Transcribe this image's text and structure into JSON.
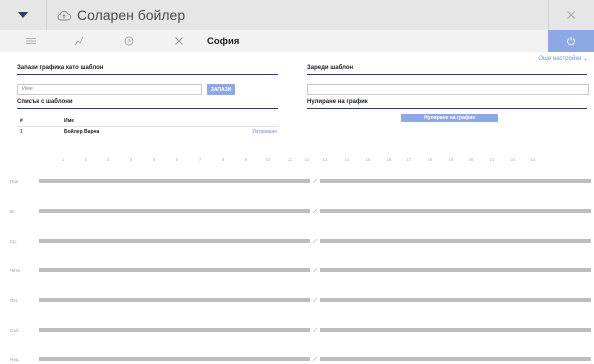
{
  "header": {
    "title": "Соларен бойлер"
  },
  "tabs": {
    "city": "София"
  },
  "more_settings": "Още настройки ⌄",
  "save_template": {
    "title": "Запази графика като шаблон",
    "name_placeholder": "Име",
    "save_button": "ЗАПАЗИ"
  },
  "load_template": {
    "title": "Зареди шаблон",
    "value": ""
  },
  "template_list": {
    "title": "Списък с шаблони",
    "columns": [
      "#",
      "Име"
    ],
    "rows": [
      {
        "num": "1",
        "name": "Бойлер Варна",
        "action": "Изтриване"
      }
    ]
  },
  "reset_schedule": {
    "title": "Нулиране на график",
    "button": "Нулиране на график"
  },
  "hours": [
    "1",
    "2",
    "3",
    "4",
    "5",
    "6",
    "7",
    "8",
    "9",
    "10",
    "11",
    "12",
    "13",
    "14",
    "15",
    "16",
    "17",
    "18",
    "19",
    "20",
    "21",
    "22",
    "23"
  ],
  "days": [
    "Пон.",
    "Вт.",
    "Ср.",
    "Четв.",
    "Пет.",
    "Съб.",
    "Нед."
  ],
  "colors": {
    "accent": "#8ea8e6",
    "section_line": "#2f3b6b",
    "bar": "#bdbdbd",
    "link": "#6f8fd8"
  }
}
